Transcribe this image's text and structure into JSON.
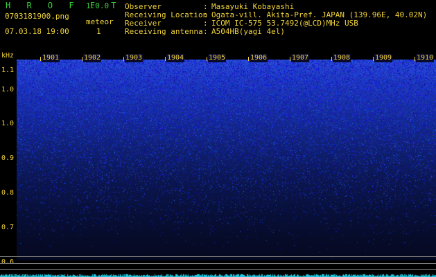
{
  "header": {
    "app_title": "H R O F F T",
    "app_version": "1.0.0",
    "file_name": "0703181900.png",
    "meteor_label": "meteor",
    "meteor_count": "1",
    "datetime": "07.03.18 19:00",
    "info": [
      {
        "key": "Observer",
        "sep": ":",
        "value": "Masayuki Kobayashi"
      },
      {
        "key": "Receiving Location",
        "sep": ":",
        "value": "Ogata-vill. Akita-Pref. JAPAN (139.96E, 40.02N)"
      },
      {
        "key": "Receiver",
        "sep": ":",
        "value": "ICOM IC-575 53.7492(@LCD)MHz USB"
      },
      {
        "key": "Receiving antenna",
        "sep": ":",
        "value": "A504HB(yagi 4el)"
      }
    ]
  },
  "axis": {
    "unit": "kHz",
    "y_labels": [
      "1.1",
      "1.0",
      "0.9",
      "0.8",
      "0.7",
      "0.6"
    ],
    "time_labels": [
      "1901",
      "1902",
      "1903",
      "1904",
      "1905",
      "1906",
      "1907",
      "1908",
      "1909",
      "1910"
    ]
  },
  "colors": {
    "label": "#f0d23a",
    "title": "#3ad13a",
    "spectrum_high": "#2d4fd8",
    "spectrum_low": "#050920",
    "signal": "#20c8e0"
  }
}
